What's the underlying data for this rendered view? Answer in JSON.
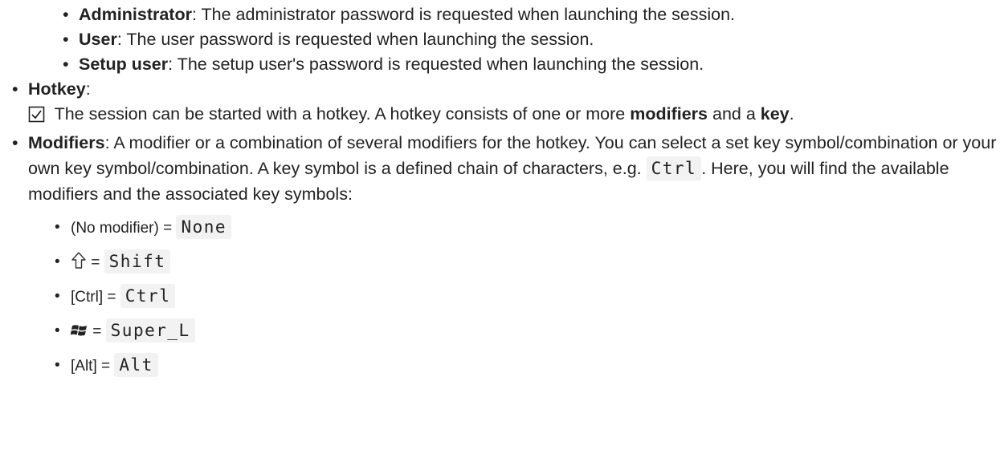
{
  "roles": [
    {
      "term": "Administrator",
      "text": ": The administrator password is requested when launching the session."
    },
    {
      "term": "User",
      "text": ": The user password is requested when launching the session."
    },
    {
      "term": "Setup user",
      "text": ": The setup user's password is requested when launching the session."
    }
  ],
  "hotkey": {
    "term": "Hotkey",
    "colon": ":",
    "desc_start": " The session can be started with a hotkey. A hotkey consists of one or more ",
    "desc_bold1": "modifiers",
    "desc_mid": " and a ",
    "desc_bold2": "key",
    "desc_end": "."
  },
  "modifiers": {
    "term": "Modifiers",
    "text_start": ": A modifier or a combination of several modifiers for the hotkey. You can select a set key symbol/combination or your own key symbol/combination. A key symbol is a defined chain of characters, e.g. ",
    "example_code": "Ctrl",
    "text_end": ". Here, you will find the available modifiers and the associated key symbols:"
  },
  "modifier_list": [
    {
      "label": "(No modifier) = ",
      "code": "None"
    },
    {
      "icon": "shift-arrow-icon",
      "label": " = ",
      "code": "Shift"
    },
    {
      "label": "[Ctrl] = ",
      "code": "Ctrl"
    },
    {
      "icon": "windows-logo-icon",
      "label": " = ",
      "code": "Super_L"
    },
    {
      "label": "[Alt] = ",
      "code": "Alt"
    }
  ]
}
